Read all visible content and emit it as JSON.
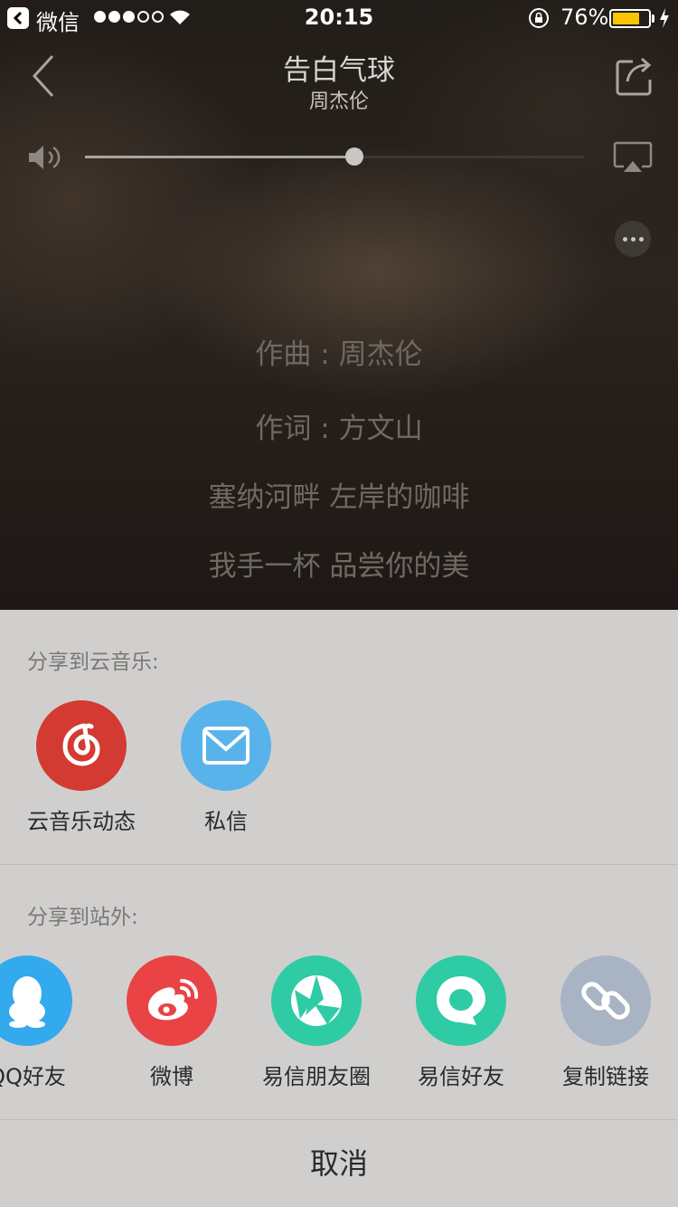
{
  "status_bar": {
    "back_app": "微信",
    "time": "20:15",
    "battery_pct": "76%",
    "battery_level": 0.76,
    "signal_bars_filled": 3,
    "signal_bars_total": 5
  },
  "player": {
    "title": "告白气球",
    "artist": "周杰伦",
    "volume": 0.54,
    "lyrics": [
      "作曲 : 周杰伦",
      "作词 : 方文山",
      "塞纳河畔  左岸的咖啡",
      "我手一杯  品尝你的美"
    ]
  },
  "share_sheet": {
    "internal_title": "分享到云音乐:",
    "internal_items": [
      {
        "label": "云音乐动态",
        "icon": "netease-music-icon",
        "color": "#d33a31"
      },
      {
        "label": "私信",
        "icon": "mail-icon",
        "color": "#58b3ea"
      }
    ],
    "external_title": "分享到站外:",
    "external_items": [
      {
        "label": "QQ好友",
        "icon": "qq-icon",
        "color": "#33a9ee"
      },
      {
        "label": "微博",
        "icon": "weibo-icon",
        "color": "#e94346"
      },
      {
        "label": "易信朋友圈",
        "icon": "yixin-moments-icon",
        "color": "#2fcba4"
      },
      {
        "label": "易信好友",
        "icon": "yixin-friend-icon",
        "color": "#2fcba4"
      },
      {
        "label": "复制链接",
        "icon": "link-icon",
        "color": "#a8b3c4"
      }
    ],
    "cancel_label": "取消"
  }
}
